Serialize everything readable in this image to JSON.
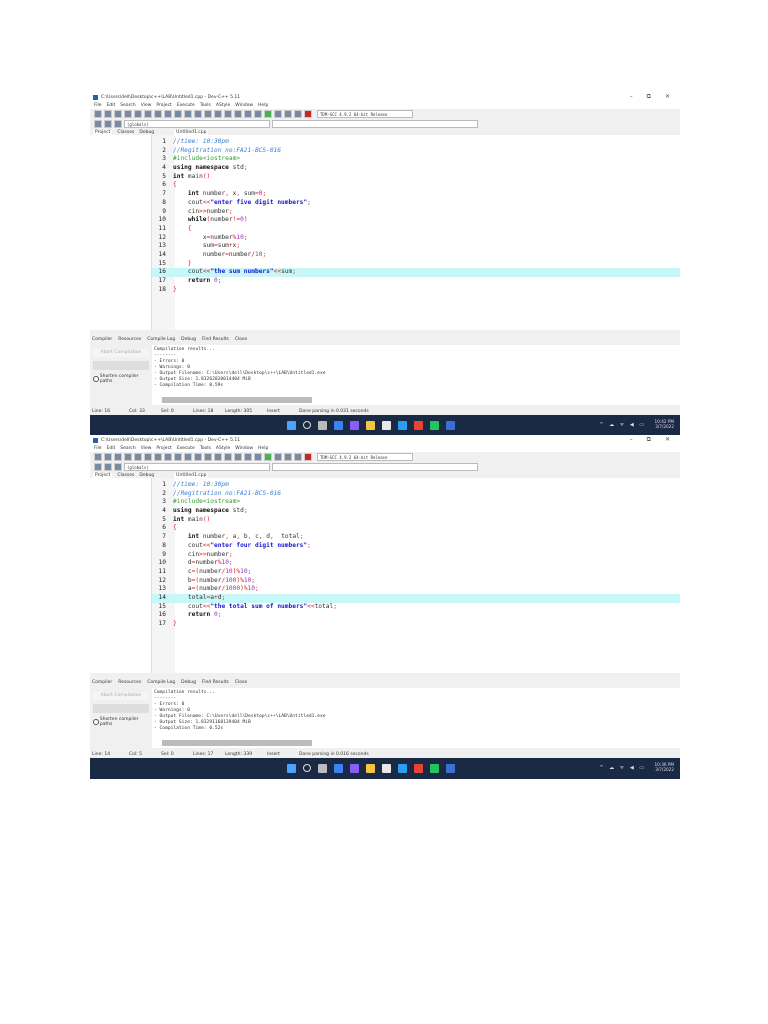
{
  "screenshots": [
    {
      "window_title": "C:\\Users\\dell\\Desktop\\c++\\LAB\\Untitled1.cpp - Dev-C++ 5.11",
      "menu": [
        "File",
        "Edit",
        "Search",
        "View",
        "Project",
        "Execute",
        "Tools",
        "AStyle",
        "Window",
        "Help"
      ],
      "compiler_select": "TDM-GCC 4.9.2 64-bit Release",
      "scope_select": "(globals)",
      "panel_tabs": [
        "Project",
        "Classes",
        "Debug"
      ],
      "file_tab": "Untitled1.cpp",
      "highlight_line": 16,
      "code": [
        "//time: 10:30pm",
        "//Regitration no:FA21-BCS-016",
        "#include<iostream>",
        "using namespace std;",
        "int main()",
        "{",
        "    int number, x, sum=0;",
        "    cout<<\"enter five digit numbers\";",
        "    cin>>number;",
        "    while(number!=0)",
        "    {",
        "        x=number%10;",
        "        sum=sum+x;",
        "        number=number/10;",
        "    }",
        "    cout<<\"the sum numbers\"<<sum;",
        "    return 0;",
        "}"
      ],
      "bottom_tabs": [
        "Compiler",
        "Resources",
        "Compile Log",
        "Debug",
        "Find Results",
        "Close"
      ],
      "abort_label": "Abort Compilation",
      "shorten_label": "Shorten compiler paths",
      "log": [
        "Compilation results...",
        "--------",
        "- Errors: 0",
        "- Warnings: 0",
        "- Output Filename: C:\\Users\\dell\\Desktop\\c++\\LAB\\Untitled1.exe",
        "- Output Size: 1.83262820014404 MiB",
        "- Compilation Time: 0.59s"
      ],
      "status": {
        "line": "Line: 16",
        "col": "Col: 33",
        "sel": "Sel: 0",
        "lines": "Lines: 18",
        "length": "Length: 305",
        "mode": "Insert",
        "parse": "Done parsing in 0.031 seconds"
      },
      "clock": {
        "time": "10:42 PM",
        "date": "3/7/2022"
      }
    },
    {
      "window_title": "C:\\Users\\dell\\Desktop\\c++\\LAB\\Untitled1.cpp - Dev-C++ 5.11",
      "menu": [
        "File",
        "Edit",
        "Search",
        "View",
        "Project",
        "Execute",
        "Tools",
        "AStyle",
        "Window",
        "Help"
      ],
      "compiler_select": "TDM-GCC 4.9.2 64-bit Release",
      "scope_select": "(globals)",
      "panel_tabs": [
        "Project",
        "Classes",
        "Debug"
      ],
      "file_tab": "Untitled1.cpp",
      "highlight_line": 14,
      "code": [
        "//time: 10:30pm",
        "//Regitration no:FA21-BCS-016",
        "#include<iostream>",
        "using namespace std;",
        "int main()",
        "{",
        "    int number, a, b, c, d,  total;",
        "    cout<<\"enter four digit numbers\";",
        "    cin>>number;",
        "    d=number%10;",
        "    c=(number/10)%10;",
        "    b=(number/100)%10;",
        "    a=(number/1000)%10;",
        "    total=a+d;",
        "    cout<<\"the total sum of numbers\"<<total;",
        "    return 0;",
        "}"
      ],
      "bottom_tabs": [
        "Compiler",
        "Resources",
        "Compile Log",
        "Debug",
        "Find Results",
        "Close"
      ],
      "abort_label": "Abort Compilation",
      "shorten_label": "Shorten compiler paths",
      "log": [
        "Compilation results...",
        "--------",
        "- Errors: 0",
        "- Warnings: 0",
        "- Output Filename: C:\\Users\\dell\\Desktop\\c++\\LAB\\Untitled1.exe",
        "- Output Size: 1.83291168139404 MiB",
        "- Compilation Time: 0.52s"
      ],
      "status": {
        "line": "Line: 14",
        "col": "Col: 5",
        "sel": "Sel: 0",
        "lines": "Lines: 17",
        "length": "Length: 339",
        "mode": "Insert",
        "parse": "Done parsing in 0.016 seconds"
      },
      "clock": {
        "time": "10:36 PM",
        "date": "3/7/2022"
      }
    }
  ],
  "window_controls": {
    "minimize": "–",
    "maximize": "⧉",
    "close": "✕"
  },
  "colors": {
    "highlight": "#c8f7f7",
    "taskbar": "#1b2a44",
    "comment": "#3a7fd5",
    "string": "#1a1ad0"
  }
}
